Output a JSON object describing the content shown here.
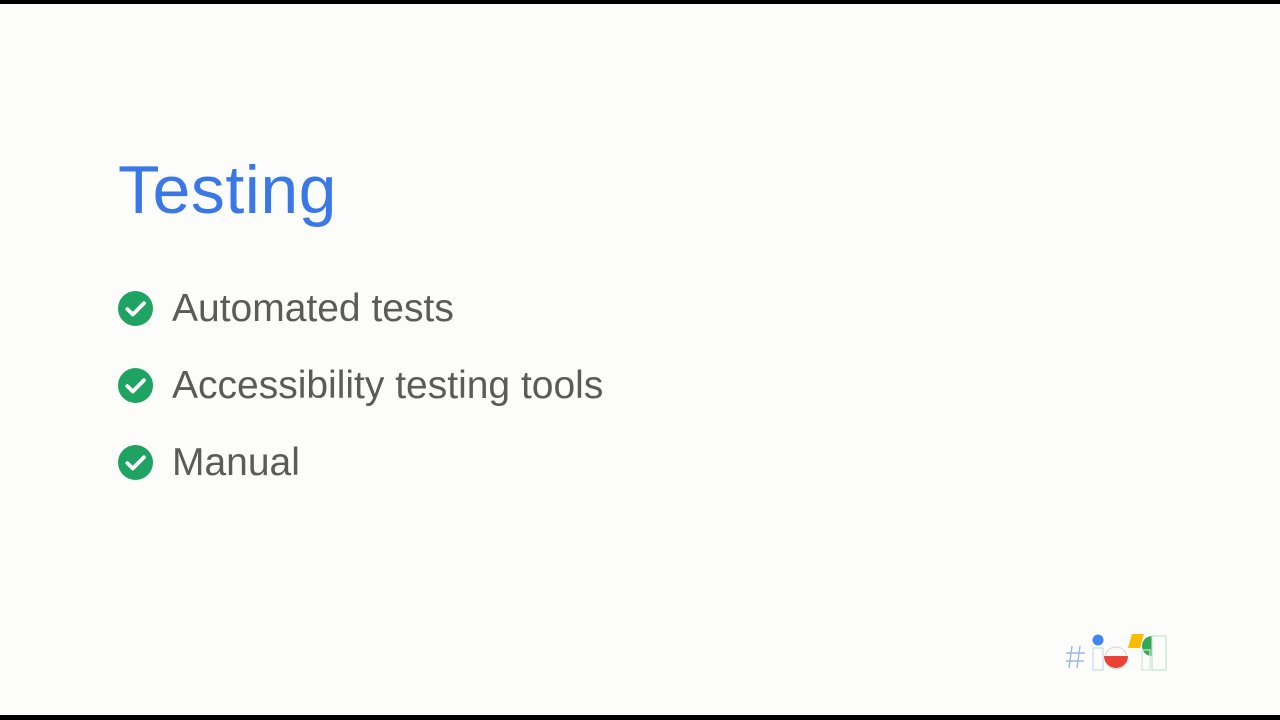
{
  "slide": {
    "title": "Testing",
    "bullets": [
      {
        "label": "Automated tests",
        "icon": "check-circle-icon"
      },
      {
        "label": "Accessibility testing tools",
        "icon": "check-circle-icon"
      },
      {
        "label": "Manual",
        "icon": "check-circle-icon"
      }
    ]
  },
  "logo": {
    "icon": "google-io-logo-icon"
  },
  "colors": {
    "background": "#fcfdfb",
    "title": "#3b78e7",
    "bullet_text": "#5b5b5b",
    "check": "#1ea362",
    "logo_blue": "#4285f4",
    "logo_red": "#ea4335",
    "logo_yellow": "#fbbc04",
    "logo_green": "#34a853"
  }
}
